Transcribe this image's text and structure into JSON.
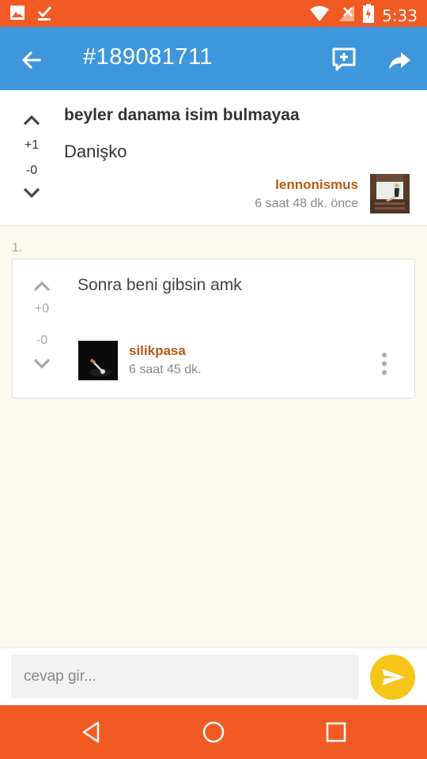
{
  "status_bar": {
    "time": "5:33",
    "icons": [
      "image-icon",
      "download-done-icon",
      "wifi-icon",
      "no-signal-icon",
      "battery-charging-icon"
    ]
  },
  "app_bar": {
    "title": "#189081711",
    "icons": [
      "back-arrow-icon",
      "add-entry-icon",
      "share-icon"
    ]
  },
  "topic": {
    "heading": "beyler danama isim bulmayaa",
    "body": "Danişko",
    "upvotes": "+1",
    "downvotes": "-0",
    "author": "lennonismus",
    "time": "6 saat 48 dk. önce"
  },
  "entries": [
    {
      "index": "1.",
      "text": "Sonra beni gibsin amk",
      "upvotes": "+0",
      "downvotes": "-0",
      "author": "silikpasa",
      "time": "6 saat 45 dk."
    }
  ],
  "reply": {
    "placeholder": "cevap gir..."
  },
  "colors": {
    "status_bar": "#f25a23",
    "app_bar": "#3e97db",
    "author": "#b45a14",
    "send_button": "#f5c518",
    "background": "#fbf8f0"
  }
}
